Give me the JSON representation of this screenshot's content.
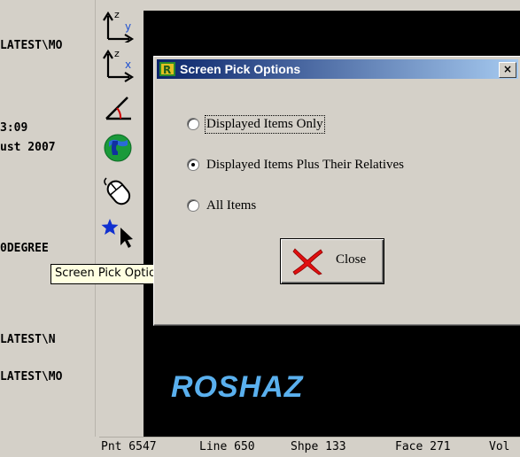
{
  "left_panel": {
    "lines": [
      "LATEST\\MO",
      "3:09",
      "ust  2007",
      "0DEGREE",
      "LATEST\\N",
      "LATEST\\MO"
    ]
  },
  "toolbar": {
    "tools": [
      {
        "icon": "axis-zy-icon"
      },
      {
        "icon": "axis-zx-icon"
      },
      {
        "icon": "angle-icon"
      },
      {
        "icon": "globe-phone-icon"
      },
      {
        "icon": "mouse-icon"
      },
      {
        "icon": "star-pick-icon"
      }
    ],
    "tooltip": "Screen Pick Options"
  },
  "dialog": {
    "title": "Screen Pick Options",
    "close_glyph": "×",
    "options": [
      {
        "label": "Displayed Items Only",
        "checked": false
      },
      {
        "label": "Displayed Items Plus Their Relatives",
        "checked": true
      },
      {
        "label": "All Items",
        "checked": false
      }
    ],
    "close_button": "Close"
  },
  "canvas": {
    "brand": "ROSHAZ"
  },
  "status_bar": {
    "items": [
      "Pnt 6547",
      "Line 650",
      "Shpe 133",
      "Face 271",
      "Vol"
    ]
  },
  "colors": {
    "canvas_bg": "#000000",
    "brand": "#5ab0ee",
    "title_gradient_start": "#0a246a",
    "title_gradient_end": "#a6caf0",
    "tooltip_bg": "#ffffe1"
  }
}
